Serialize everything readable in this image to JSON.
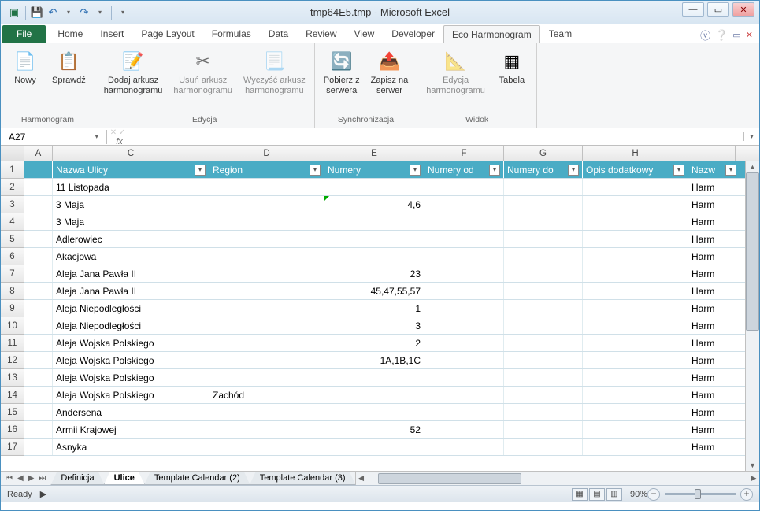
{
  "title": "tmp64E5.tmp - Microsoft Excel",
  "tabs": {
    "file": "File",
    "items": [
      "Home",
      "Insert",
      "Page Layout",
      "Formulas",
      "Data",
      "Review",
      "View",
      "Developer",
      "Eco Harmonogram",
      "Team"
    ],
    "active": "Eco Harmonogram"
  },
  "ribbon": {
    "groups": [
      {
        "label": "Harmonogram",
        "buttons": [
          {
            "label": "Nowy",
            "icon": "📄",
            "disabled": false
          },
          {
            "label": "Sprawdź",
            "icon": "📋",
            "disabled": false
          }
        ]
      },
      {
        "label": "Edycja",
        "buttons": [
          {
            "label": "Dodaj arkusz\nharmonogramu",
            "icon": "📝",
            "disabled": false
          },
          {
            "label": "Usuń arkusz\nharmonogramu",
            "icon": "✂",
            "disabled": true
          },
          {
            "label": "Wyczyść arkusz\nharmonogramu",
            "icon": "📃",
            "disabled": true
          }
        ]
      },
      {
        "label": "Synchronizacja",
        "buttons": [
          {
            "label": "Pobierz z\nserwera",
            "icon": "🔄",
            "disabled": false
          },
          {
            "label": "Zapisz na\nserwer",
            "icon": "📤",
            "disabled": false
          }
        ]
      },
      {
        "label": "Widok",
        "buttons": [
          {
            "label": "Edycja\nharmonogramu",
            "icon": "📐",
            "disabled": true
          },
          {
            "label": "Tabela",
            "icon": "▦",
            "disabled": false
          }
        ]
      }
    ]
  },
  "nameBox": "A27",
  "fx": "fx",
  "formula": "",
  "columns": [
    "A",
    "C",
    "D",
    "E",
    "F",
    "G",
    "H"
  ],
  "headers": {
    "C": "Nazwa Ulicy",
    "D": "Region",
    "E": "Numery",
    "F": "Numery od",
    "G": "Numery do",
    "H": "Opis dodatkowy",
    "I": "Nazw"
  },
  "rows": [
    {
      "n": 1,
      "header": true
    },
    {
      "n": 2,
      "C": "11 Listopada",
      "I": "Harm"
    },
    {
      "n": 3,
      "C": "3 Maja",
      "E": "4,6",
      "Egreen": true,
      "I": "Harm"
    },
    {
      "n": 4,
      "C": "3 Maja",
      "I": "Harm"
    },
    {
      "n": 5,
      "C": "Adlerowiec",
      "I": "Harm"
    },
    {
      "n": 6,
      "C": "Akacjowa",
      "I": "Harm"
    },
    {
      "n": 7,
      "C": "Aleja Jana Pawła II",
      "E": "23",
      "I": "Harm"
    },
    {
      "n": 8,
      "C": "Aleja Jana Pawła II",
      "E": "45,47,55,57",
      "I": "Harm"
    },
    {
      "n": 9,
      "C": "Aleja Niepodległości",
      "E": "1",
      "I": "Harm"
    },
    {
      "n": 10,
      "C": "Aleja Niepodległości",
      "E": "3",
      "I": "Harm"
    },
    {
      "n": 11,
      "C": "Aleja Wojska Polskiego",
      "E": "2",
      "I": "Harm"
    },
    {
      "n": 12,
      "C": "Aleja Wojska Polskiego",
      "E": "1A,1B,1C",
      "I": "Harm"
    },
    {
      "n": 13,
      "C": "Aleja Wojska Polskiego",
      "I": "Harm"
    },
    {
      "n": 14,
      "C": "Aleja Wojska Polskiego",
      "D": "Zachód",
      "I": "Harm"
    },
    {
      "n": 15,
      "C": "Andersena",
      "I": "Harm"
    },
    {
      "n": 16,
      "C": "Armii Krajowej",
      "E": "52",
      "I": "Harm"
    },
    {
      "n": 17,
      "C": "Asnyka",
      "I": "Harm"
    }
  ],
  "sheets": {
    "items": [
      "Definicja",
      "Ulice",
      "Template Calendar (2)",
      "Template Calendar (3)"
    ],
    "active": "Ulice"
  },
  "status": "Ready",
  "zoom": "90%"
}
